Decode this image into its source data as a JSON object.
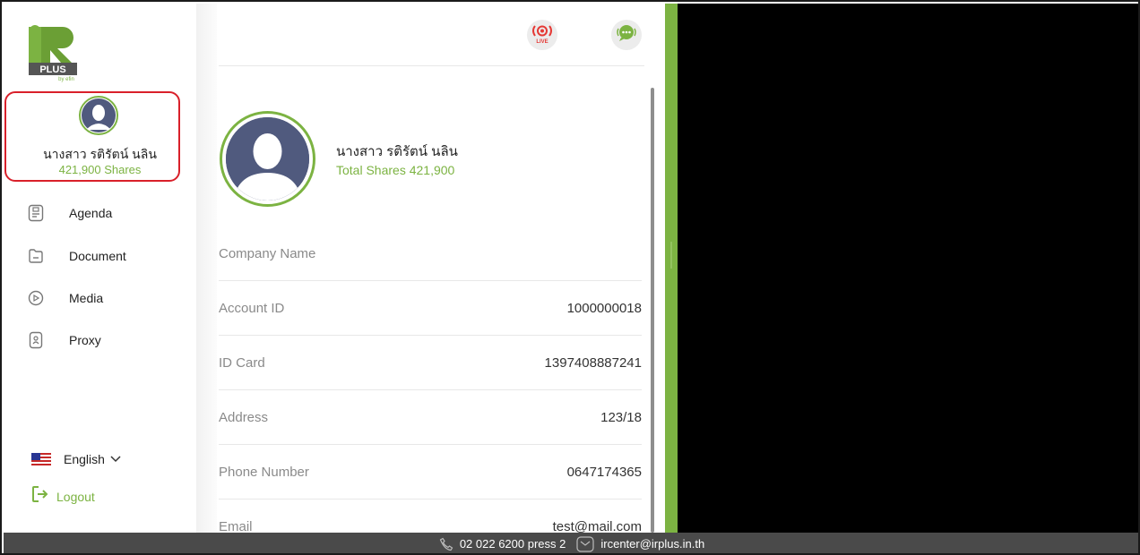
{
  "sidebar": {
    "logo_text": "iR PLUS",
    "logo_sub": "by efin",
    "user": {
      "name": "นางสาว รติรัตน์ นลิน",
      "shares": "421,900 Shares"
    },
    "menu": [
      {
        "label": "Agenda",
        "icon": "agenda-icon"
      },
      {
        "label": "Document",
        "icon": "folder-icon"
      },
      {
        "label": "Media",
        "icon": "play-icon"
      },
      {
        "label": "Proxy",
        "icon": "proxy-icon"
      }
    ],
    "language": {
      "label": "English",
      "flag": "us-flag-icon"
    },
    "logout_label": "Logout"
  },
  "header": {
    "live_label": "LIVE",
    "live_icon": "live-broadcast-icon",
    "chat_icon": "chat-bubble-icon"
  },
  "profile": {
    "name": "นางสาว รติรัตน์ นลิน",
    "total_shares": "Total Shares 421,900",
    "fields": [
      {
        "label": "Company Name",
        "value": ""
      },
      {
        "label": "Account ID",
        "value": "1000000018"
      },
      {
        "label": "ID Card",
        "value": "1397408887241"
      },
      {
        "label": "Address",
        "value": "123/18"
      },
      {
        "label": "Phone Number",
        "value": "0647174365"
      },
      {
        "label": "Email",
        "value": "test@mail.com"
      }
    ]
  },
  "footer": {
    "phone": "02 022 6200 press 2",
    "email": "ircenter@irplus.in.th"
  },
  "colors": {
    "accent_green": "#7cb342",
    "highlight_red": "#d9202a",
    "live_red": "#e53935",
    "footer_bg": "#4a4a4a"
  }
}
